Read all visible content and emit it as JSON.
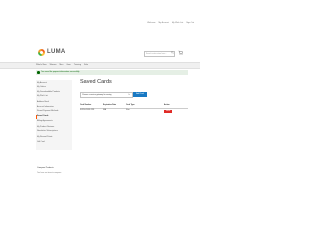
{
  "header": {
    "top_links": [
      "Welcome",
      "My Account",
      "My Wish List",
      "Sign Out"
    ],
    "logo_text": "LUMA",
    "search_placeholder": "Search entire store here...",
    "cart_icon": "cart-icon",
    "search_icon": "search-icon"
  },
  "nav": {
    "items": [
      "What's New",
      "Women",
      "Men",
      "Gear",
      "Training",
      "Sale"
    ]
  },
  "message": {
    "text": "You saved the payment information successfully."
  },
  "sidebar": {
    "items": [
      {
        "label": "My Account"
      },
      {
        "label": "My Orders"
      },
      {
        "label": "My Downloadable Products"
      },
      {
        "label": "My Wish List"
      },
      {
        "label": "Address Book"
      },
      {
        "label": "Account Information"
      },
      {
        "label": "Stored Payment Methods"
      },
      {
        "label": "Saved Cards",
        "active": true
      },
      {
        "label": "Billing Agreements"
      },
      {
        "label": "My Product Reviews"
      },
      {
        "label": "Newsletter Subscriptions"
      },
      {
        "label": "My Reward Points"
      },
      {
        "label": "Gift Card"
      }
    ],
    "compare_title": "Compare Products",
    "compare_text": "You have no items to compare."
  },
  "main": {
    "page_title": "Saved Cards",
    "select_value": "Choose a service gateway for saving",
    "add_button": "Add Card",
    "table": {
      "headers": [
        "Card Number",
        "Expiration Date",
        "Card Type",
        "Action"
      ],
      "rows": [
        {
          "card_number": "XXXX-XXXX-1111",
          "expiration": "N/A",
          "card_type": "Visa",
          "action": "Delete"
        }
      ]
    }
  },
  "colors": {
    "accent": "#1979c3",
    "danger": "#e02b27",
    "success_bg": "#e5efe5",
    "success_text": "#006400",
    "nav_bg": "#f0f0f0",
    "sidebar_bg": "#f5f5f5"
  }
}
